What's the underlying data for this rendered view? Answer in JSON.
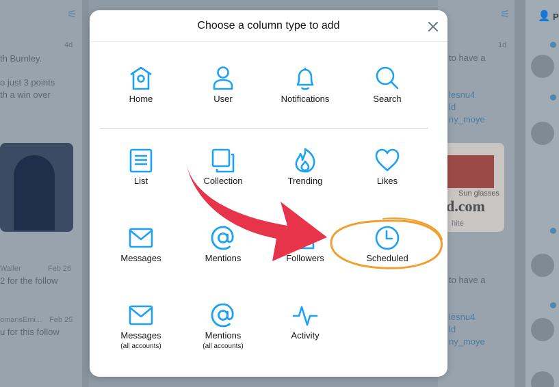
{
  "modal": {
    "title": "Choose a column type to add",
    "close_icon": "close-icon"
  },
  "options": [
    {
      "id": "home",
      "label": "Home",
      "icon": "home-icon"
    },
    {
      "id": "user",
      "label": "User",
      "icon": "user-icon"
    },
    {
      "id": "notifications",
      "label": "Notifications",
      "icon": "bell-icon"
    },
    {
      "id": "search",
      "label": "Search",
      "icon": "search-icon"
    },
    {
      "id": "list",
      "label": "List",
      "icon": "list-icon"
    },
    {
      "id": "collection",
      "label": "Collection",
      "icon": "collection-icon"
    },
    {
      "id": "trending",
      "label": "Trending",
      "icon": "flame-icon"
    },
    {
      "id": "likes",
      "label": "Likes",
      "icon": "heart-icon"
    },
    {
      "id": "messages",
      "label": "Messages",
      "icon": "envelope-icon"
    },
    {
      "id": "mentions",
      "label": "Mentions",
      "icon": "at-icon"
    },
    {
      "id": "followers",
      "label": "Followers",
      "icon": "followers-icon"
    },
    {
      "id": "scheduled",
      "label": "Scheduled",
      "icon": "clock-icon"
    },
    {
      "id": "messages_all",
      "label": "Messages",
      "sublabel": "(all accounts)",
      "icon": "envelope-icon"
    },
    {
      "id": "mentions_all",
      "label": "Mentions",
      "sublabel": "(all accounts)",
      "icon": "at-icon"
    },
    {
      "id": "activity",
      "label": "Activity",
      "icon": "activity-icon"
    }
  ],
  "background": {
    "left_column": [
      "th Burnley.",
      "o just 3 points",
      "th a win over",
      "Waller",
      "2 for the follow",
      "omansEmi...",
      "u for this follow"
    ],
    "left_times": [
      "4d",
      "Feb 26",
      "Feb 25"
    ],
    "right_column": [
      "to have a",
      "lesnu4",
      "ld",
      "ny_moye",
      "to have a",
      "lesnu4",
      "ld",
      "ny_moye"
    ],
    "right_time": "1d",
    "ad_text": "d.com",
    "ad_small": "Sun glasses",
    "ad_note": "hite",
    "header_letter": "P"
  },
  "colors": {
    "accent": "#1da1f2",
    "annotation_arrow": "#e8344a",
    "annotation_circle": "#f0a030"
  }
}
